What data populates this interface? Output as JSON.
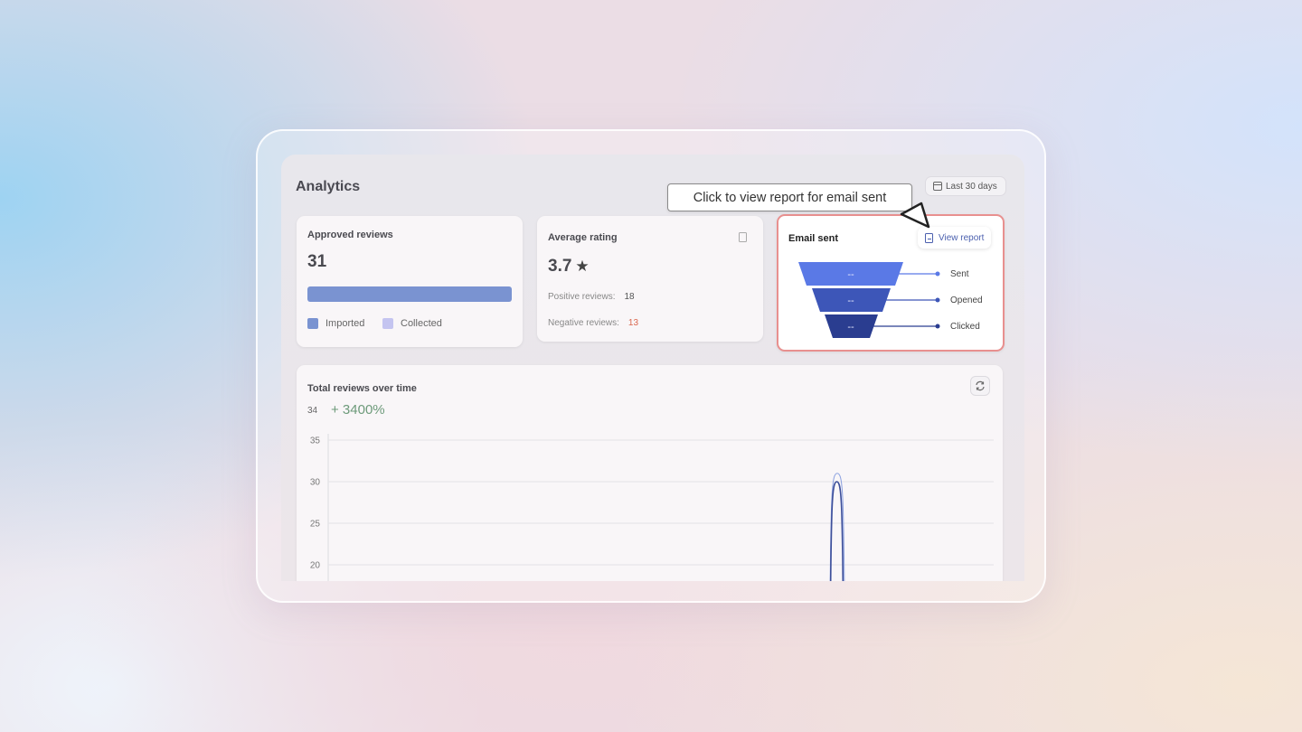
{
  "page": {
    "title": "Analytics",
    "date_range": "Last 30 days"
  },
  "approved": {
    "title": "Approved reviews",
    "value": "31",
    "bar_color": "#7a93d1",
    "legend": [
      {
        "label": "Imported",
        "color": "#7a93d1"
      },
      {
        "label": "Collected",
        "color": "#c4c4f0"
      }
    ]
  },
  "rating": {
    "title": "Average rating",
    "value": "3.7",
    "positive_label": "Positive reviews:",
    "positive_value": "18",
    "negative_label": "Negative reviews:",
    "negative_value": "13"
  },
  "email": {
    "title": "Email sent",
    "view_report": "View report",
    "stages": [
      {
        "label": "Sent",
        "value": "--",
        "color": "#5a79e6"
      },
      {
        "label": "Opened",
        "value": "--",
        "color": "#3d56b8"
      },
      {
        "label": "Clicked",
        "value": "--",
        "color": "#2a3d90"
      }
    ]
  },
  "tooltip": {
    "text": "Click to view report for email sent"
  },
  "total": {
    "title": "Total reviews over time",
    "count": "34",
    "change": "+ 3400%"
  },
  "chart_data": {
    "type": "line",
    "title": "Total reviews over time",
    "y_ticks": [
      35,
      30,
      25,
      20
    ],
    "ylim": [
      20,
      35
    ],
    "grid": true,
    "series": [
      {
        "values": [
          0,
          0,
          31,
          0,
          0
        ],
        "color": "#8aa0e0"
      },
      {
        "values": [
          0,
          0,
          30,
          0,
          0
        ],
        "color": "#3d4f9a"
      }
    ]
  }
}
